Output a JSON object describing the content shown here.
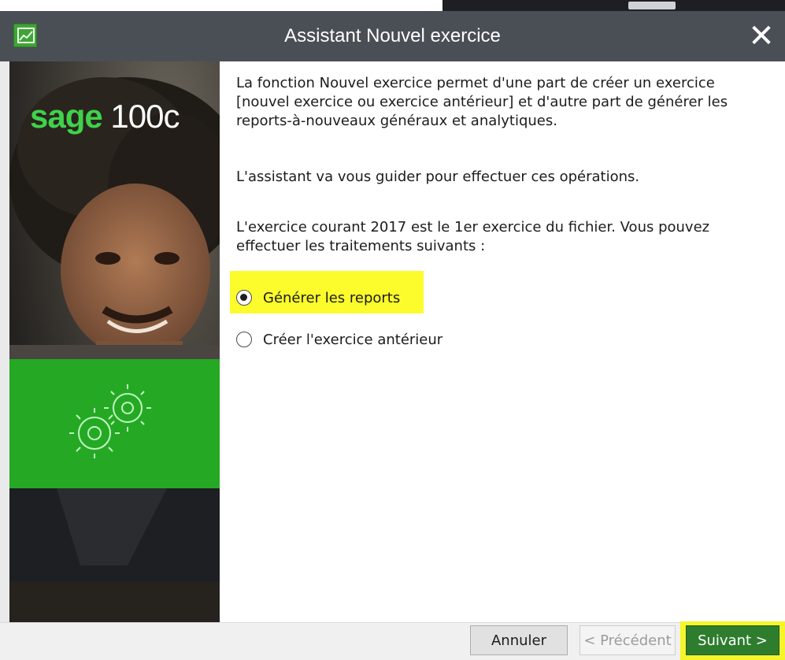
{
  "window": {
    "title": "Assistant Nouvel exercice",
    "close_glyph": "✕"
  },
  "side_panel": {
    "brand_sage": "sage",
    "brand_version": "100c",
    "accent_color": "#3fd24a",
    "band_color": "#22b022"
  },
  "content": {
    "intro": "La fonction Nouvel exercice permet d'une part de créer un exercice [nouvel exercice ou exercice antérieur] et d'autre part de générer les reports-à-nouveaux généraux et analytiques.",
    "guide": "L'assistant va vous guider pour effectuer ces opérations.",
    "status": "L'exercice courant 2017 est le 1er exercice du fichier. Vous pouvez effectuer les traitements suivants :"
  },
  "options": [
    {
      "label": "Générer les reports",
      "checked": true
    },
    {
      "label": "Créer l'exercice antérieur",
      "checked": false
    }
  ],
  "buttons": {
    "cancel": "Annuler",
    "previous": "< Précédent",
    "next": "Suivant >"
  },
  "colors": {
    "titlebar": "#4a4f55",
    "highlight": "#fcfc2d",
    "primary_button": "#2e7d2e"
  }
}
